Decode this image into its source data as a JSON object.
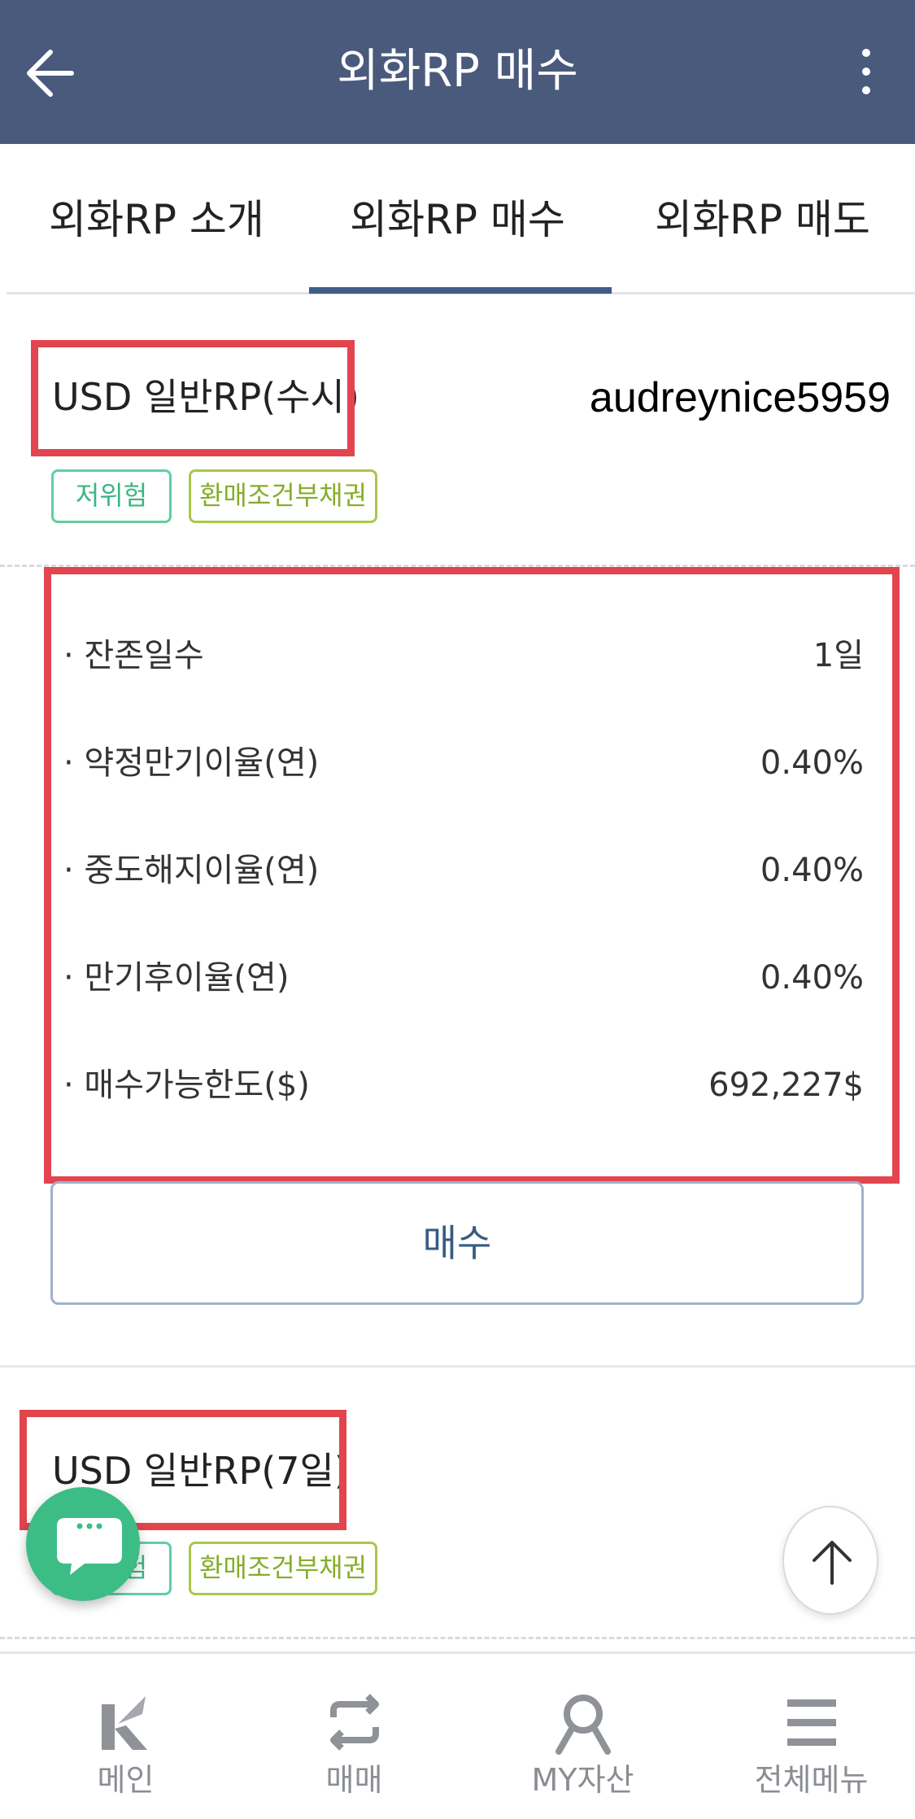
{
  "header": {
    "title": "외화RP 매수"
  },
  "tabs": [
    {
      "label": "외화RP 소개"
    },
    {
      "label": "외화RP 매수"
    },
    {
      "label": "외화RP 매도"
    }
  ],
  "products": [
    {
      "title": "USD 일반RP(수시)",
      "tags": [
        "저위험",
        "환매조건부채권"
      ],
      "details": [
        {
          "label": "· 잔존일수",
          "value": "1일"
        },
        {
          "label": "· 약정만기이율(연)",
          "value": "0.40%"
        },
        {
          "label": "· 중도해지이율(연)",
          "value": "0.40%"
        },
        {
          "label": "· 만기후이율(연)",
          "value": "0.40%"
        },
        {
          "label": "· 매수가능한도($)",
          "value": "692,227$"
        }
      ],
      "buy_label": "매수"
    },
    {
      "title": "USD 일반RP(7일)",
      "tags": [
        "저위험",
        "환매조건부채권"
      ]
    }
  ],
  "watermark": "audreynice5959",
  "bottom_nav": [
    {
      "label": "메인",
      "icon": "k-logo-icon"
    },
    {
      "label": "매매",
      "icon": "swap-icon"
    },
    {
      "label": "MY자산",
      "icon": "person-icon"
    },
    {
      "label": "전체메뉴",
      "icon": "hamburger-icon"
    }
  ],
  "colors": {
    "header_bg": "#4a5a7d",
    "accent": "#3f5d87",
    "highlight_box": "#e2454e",
    "chat_fab": "#3dbd86"
  }
}
